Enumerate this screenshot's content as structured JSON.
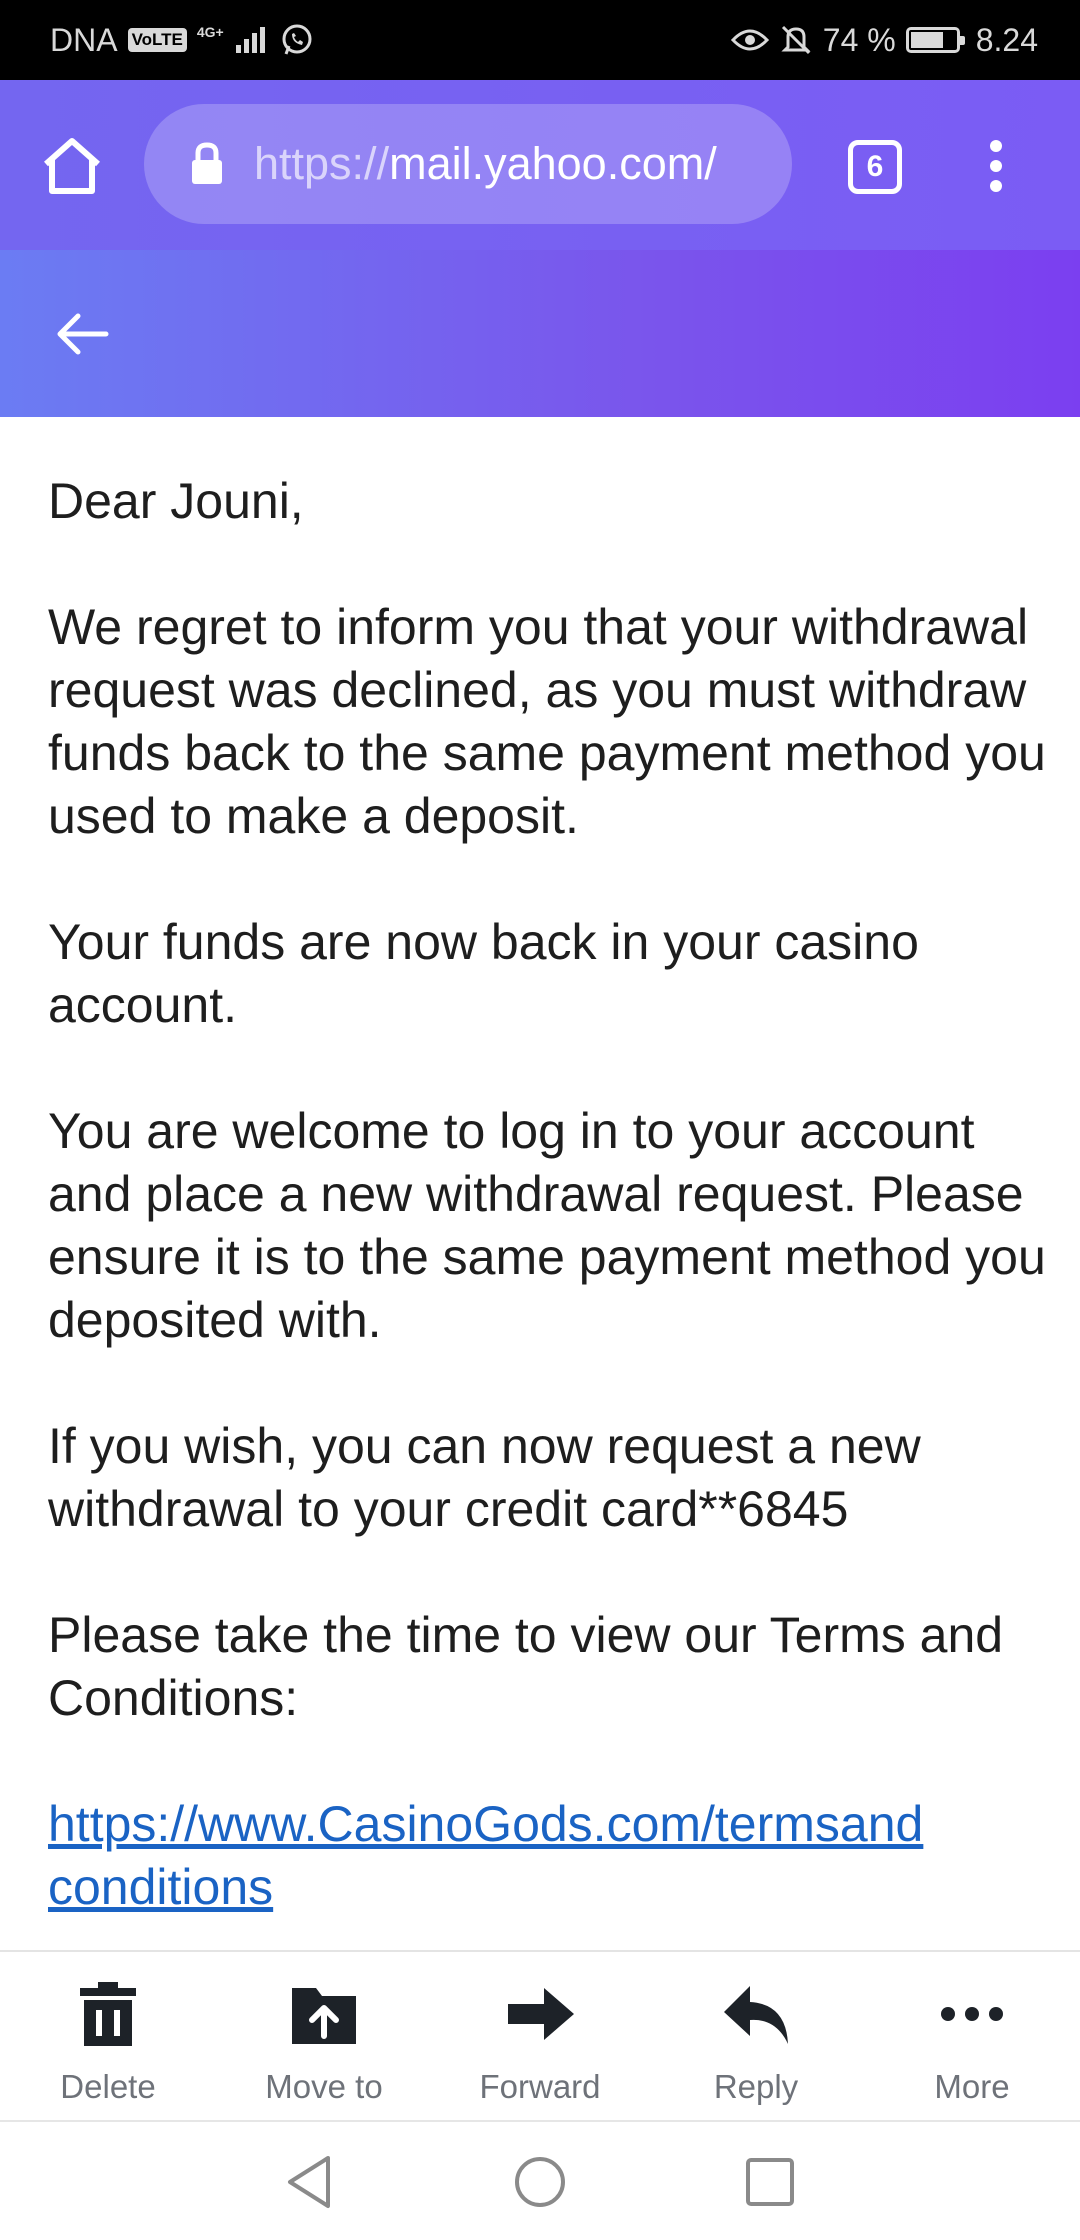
{
  "status_bar": {
    "carrier": "DNA",
    "volte": "VoLTE",
    "network": "4G+",
    "battery_percent_label": "74 %",
    "battery_level": 0.74,
    "time": "8.24",
    "icons": [
      "whatsapp-icon",
      "eye-icon",
      "bell-off-icon",
      "battery-icon",
      "signal-icon"
    ]
  },
  "browser": {
    "url_scheme": "https://",
    "url_host": "mail.yahoo.com/",
    "tab_count": "6",
    "icons": [
      "home-icon",
      "lock-icon",
      "tabs-icon",
      "more-vertical-icon"
    ]
  },
  "mail_header": {
    "icons": [
      "back-arrow-icon"
    ]
  },
  "email": {
    "greeting": "Dear Jouni,",
    "paragraph1": "We regret to inform you that your withdrawal request was declined, as you must withdraw funds back to the same payment method you used to make a deposit.",
    "paragraph2": "Your funds are now back in your casino account.",
    "paragraph3": "You are welcome to log in to your account and place a new withdrawal request. Please ensure it is to the same payment method you deposited with.",
    "paragraph4": "If you wish, you can now request a new withdrawal to your credit card**6845",
    "paragraph5": "Please take the time to view our Terms and Conditions:",
    "link_line1": "https://www.CasinoGods.com/termsand",
    "link_line2": "conditions"
  },
  "actions": {
    "delete": "Delete",
    "move_to": "Move to",
    "forward": "Forward",
    "reply": "Reply",
    "more": "More"
  },
  "colors": {
    "browser_bar": "#7466f0",
    "header_gradient_start": "#6b7cf3",
    "header_gradient_end": "#7b3ff0",
    "link": "#1a63c4",
    "action_icon": "#1d2228",
    "action_label": "#6e7279"
  }
}
